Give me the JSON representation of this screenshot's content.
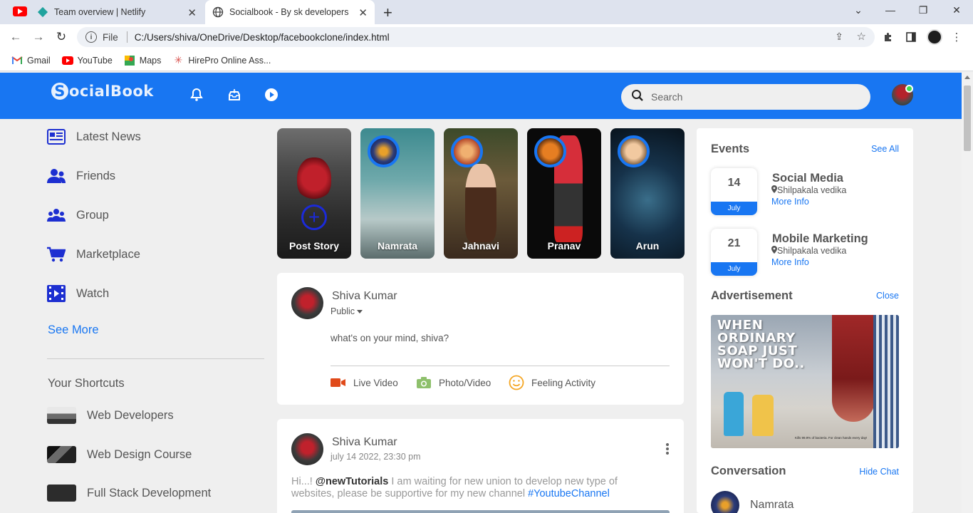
{
  "browser": {
    "tabs": [
      {
        "title": "Team overview | Netlify"
      },
      {
        "title": "Socialbook - By sk developers"
      }
    ],
    "address": {
      "file_label": "File",
      "url": "C:/Users/shiva/OneDrive/Desktop/facebookclone/index.html"
    },
    "bookmarks": [
      {
        "label": "Gmail",
        "icon": "gmail-icon"
      },
      {
        "label": "YouTube",
        "icon": "youtube-icon"
      },
      {
        "label": "Maps",
        "icon": "maps-icon"
      },
      {
        "label": "HirePro Online Ass...",
        "icon": "hirepro-icon"
      }
    ]
  },
  "site": {
    "brand_color": "#1876f2",
    "logo": "ocialBook",
    "logo_letter": "S",
    "search": {
      "placeholder": "Search"
    }
  },
  "left_sidebar": {
    "links": [
      {
        "label": "Latest News",
        "icon": "newspaper-icon"
      },
      {
        "label": "Friends",
        "icon": "friends-icon"
      },
      {
        "label": "Group",
        "icon": "group-icon"
      },
      {
        "label": "Marketplace",
        "icon": "cart-icon"
      },
      {
        "label": "Watch",
        "icon": "video-icon"
      }
    ],
    "see_more": "See More",
    "shortcuts_title": "Your Shortcuts",
    "shortcuts": [
      {
        "label": "Web Developers"
      },
      {
        "label": "Web Design Course"
      },
      {
        "label": "Full Stack Development"
      }
    ]
  },
  "stories": [
    {
      "name": "Post Story"
    },
    {
      "name": "Namrata"
    },
    {
      "name": "Jahnavi"
    },
    {
      "name": "Pranav"
    },
    {
      "name": "Arun"
    }
  ],
  "write_post": {
    "user": "Shiva Kumar",
    "privacy": "Public",
    "placeholder": "what's on your mind, shiva?",
    "actions": [
      {
        "label": "Live Video",
        "icon": "live-video-icon"
      },
      {
        "label": "Photo/Video",
        "icon": "photo-icon"
      },
      {
        "label": "Feeling Activity",
        "icon": "smiley-icon"
      }
    ]
  },
  "post": {
    "user": "Shiva Kumar",
    "date": "july 14 2022, 23:30 pm",
    "text_1": "Hi...! ",
    "mention": "@newTutorials",
    "text_2": " I am waiting for new union to develop new type of websites, please be supportive for my new channel ",
    "hashtag": "#YoutubeChannel"
  },
  "right_sidebar": {
    "events_title": "Events",
    "see_all": "See All",
    "events": [
      {
        "day": "14",
        "month": "July",
        "title": "Social Media",
        "location": "Shilpakala vedika",
        "more": "More Info"
      },
      {
        "day": "21",
        "month": "July",
        "title": "Mobile Marketing",
        "location": "Shilpakala vedika",
        "more": "More Info"
      }
    ],
    "ad_title": "Advertisement",
    "ad_close": "Close",
    "ad_headline": "WHEN ORDINARY SOAP JUST WON'T DO..",
    "ad_small": "Kills 99.9% of bacteria. For clean hands every day!",
    "conversation_title": "Conversation",
    "hide_chat": "Hide Chat",
    "conversations": [
      {
        "name": "Namrata"
      }
    ]
  }
}
